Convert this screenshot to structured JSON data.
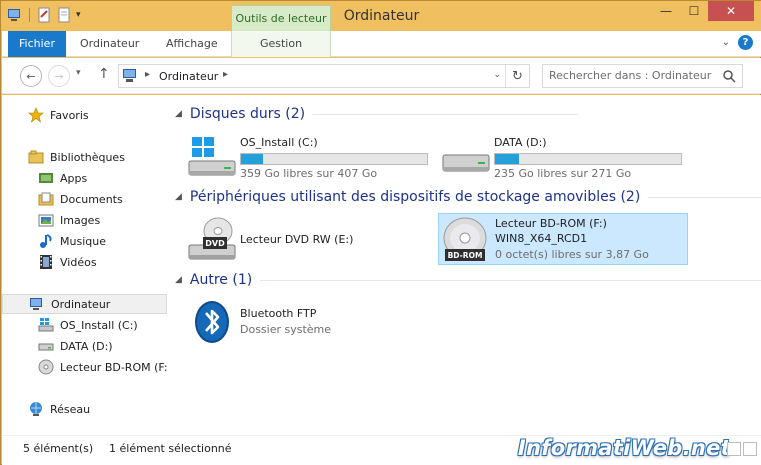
{
  "window": {
    "title": "Ordinateur",
    "contextual_tab_title": "Outils de lecteur"
  },
  "ribbon": {
    "tabs": [
      {
        "label": "Fichier"
      },
      {
        "label": "Ordinateur"
      },
      {
        "label": "Affichage"
      },
      {
        "label": "Gestion"
      }
    ]
  },
  "address": {
    "crumb": "Ordinateur",
    "search_placeholder": "Rechercher dans : Ordinateur"
  },
  "navpane": {
    "items": [
      {
        "label": "Favoris",
        "icon": "star-icon"
      },
      {
        "label": "Bibliothèques",
        "icon": "libraries-icon"
      },
      {
        "label": "Apps",
        "icon": "apps-icon"
      },
      {
        "label": "Documents",
        "icon": "documents-icon"
      },
      {
        "label": "Images",
        "icon": "images-icon"
      },
      {
        "label": "Musique",
        "icon": "music-icon"
      },
      {
        "label": "Vidéos",
        "icon": "videos-icon"
      },
      {
        "label": "Ordinateur",
        "icon": "computer-icon",
        "selected": true
      },
      {
        "label": "OS_Install (C:)",
        "icon": "windows-drive-icon"
      },
      {
        "label": "DATA (D:)",
        "icon": "drive-icon"
      },
      {
        "label": "Lecteur BD-ROM (F:",
        "icon": "disc-icon"
      },
      {
        "label": "Réseau",
        "icon": "network-icon"
      }
    ]
  },
  "groups": {
    "hard_drives": {
      "header": "Disques durs (2)",
      "items": [
        {
          "name": "OS_Install (C:)",
          "free": "359 Go libres sur 407 Go",
          "used_fraction": 0.12,
          "icon": "windows-hard-drive-icon"
        },
        {
          "name": "DATA (D:)",
          "free": "235 Go libres sur 271 Go",
          "used_fraction": 0.13,
          "icon": "hard-drive-icon"
        }
      ]
    },
    "removable": {
      "header": "Périphériques utilisant des dispositifs de stockage amovibles (2)",
      "items": [
        {
          "name": "Lecteur DVD RW (E:)",
          "icon": "dvd-drive-icon",
          "badge": "DVD"
        },
        {
          "name": "Lecteur BD-ROM (F:)",
          "label": "WIN8_X64_RCD1",
          "free": "0 octet(s) libres sur 3,87 Go",
          "icon": "bd-rom-disc-icon",
          "badge": "BD-ROM",
          "selected": true
        }
      ]
    },
    "other": {
      "header": "Autre (1)",
      "items": [
        {
          "name": "Bluetooth FTP",
          "sub": "Dossier système",
          "icon": "bluetooth-icon"
        }
      ]
    }
  },
  "status": {
    "count": "5 élément(s)",
    "selected": "1 élément sélectionné",
    "watermark": "InformatiWeb.net"
  },
  "colors": {
    "accent": "#1979ca",
    "frame": "#f0c060",
    "selection": "#cce8ff",
    "group_header": "#1e3287",
    "bar_fill": "#26a0da"
  }
}
